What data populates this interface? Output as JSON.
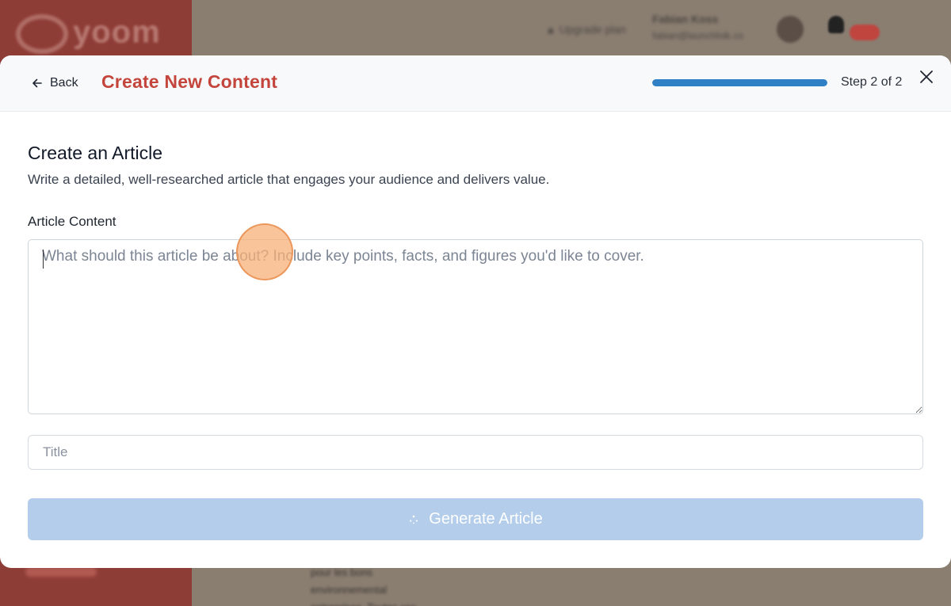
{
  "background": {
    "logo_text": "yoom",
    "header_link": "Upgrade plan",
    "user_name": "Fabian Koss",
    "user_email": "fabian@launchfolk.co",
    "list_lines": [
      "pour les bons",
      "environnemental",
      "entreprises. Toutes ces"
    ]
  },
  "header": {
    "back_label": "Back",
    "title": "Create New Content",
    "step_text": "Step 2 of 2",
    "progress_fraction": 1.0
  },
  "section": {
    "title": "Create an Article",
    "description": "Write a detailed, well-researched article that engages your audience and delivers value."
  },
  "content_field": {
    "label": "Article Content",
    "placeholder": "What should this article be about? Include key points, facts, and figures you'd like to cover.",
    "value": ""
  },
  "title_field": {
    "placeholder": "Title",
    "value": ""
  },
  "generate_button": {
    "label": "Generate Article",
    "disabled": true
  },
  "colors": {
    "title_red": "#c4453b",
    "progress_blue": "#2f80c5",
    "button_disabled": "#b3cdea"
  },
  "icons": {
    "back": "arrow-left-icon",
    "close": "close-icon",
    "generate": "sparkle-icon"
  }
}
